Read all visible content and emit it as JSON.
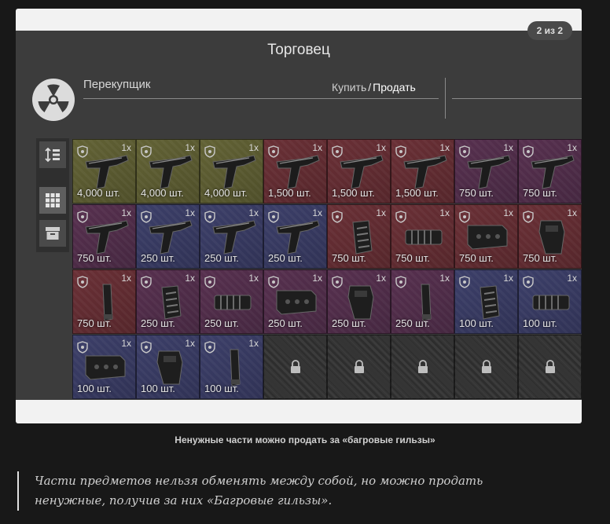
{
  "gallery": {
    "counter": "2 из 2"
  },
  "trader": {
    "title": "Торговец",
    "name": "Перекупщик",
    "buy_label": "Купить",
    "separator": "/",
    "sell_label": "Продать"
  },
  "sidebar": {
    "icons": [
      "sort-icon",
      "grid-view-icon",
      "box-icon"
    ]
  },
  "grid": {
    "cells": [
      {
        "color": "yellow",
        "qty": "1x",
        "amount": "4,000 шт.",
        "item": "pistol"
      },
      {
        "color": "yellow",
        "qty": "1x",
        "amount": "4,000 шт.",
        "item": "pistol"
      },
      {
        "color": "yellow",
        "qty": "1x",
        "amount": "4,000 шт.",
        "item": "pistol"
      },
      {
        "color": "red",
        "qty": "1x",
        "amount": "1,500 шт.",
        "item": "pistol"
      },
      {
        "color": "red",
        "qty": "1x",
        "amount": "1,500 шт.",
        "item": "pistol"
      },
      {
        "color": "red",
        "qty": "1x",
        "amount": "1,500 шт.",
        "item": "pistol"
      },
      {
        "color": "purple",
        "qty": "1x",
        "amount": "750 шт.",
        "item": "pistol"
      },
      {
        "color": "purple",
        "qty": "1x",
        "amount": "750 шт.",
        "item": "pistol"
      },
      {
        "color": "purple",
        "qty": "1x",
        "amount": "750 шт.",
        "item": "pistol"
      },
      {
        "color": "blue",
        "qty": "1x",
        "amount": "250 шт.",
        "item": "pistol"
      },
      {
        "color": "blue",
        "qty": "1x",
        "amount": "250 шт.",
        "item": "pistol"
      },
      {
        "color": "blue",
        "qty": "1x",
        "amount": "250 шт.",
        "item": "pistol"
      },
      {
        "color": "red",
        "qty": "1x",
        "amount": "750 шт.",
        "item": "grip"
      },
      {
        "color": "red",
        "qty": "1x",
        "amount": "750 шт.",
        "item": "muzzle"
      },
      {
        "color": "red",
        "qty": "1x",
        "amount": "750 шт.",
        "item": "handguard"
      },
      {
        "color": "red",
        "qty": "1x",
        "amount": "750 шт.",
        "item": "holster"
      },
      {
        "color": "red",
        "qty": "1x",
        "amount": "750 шт.",
        "item": "magazine"
      },
      {
        "color": "purple",
        "qty": "1x",
        "amount": "250 шт.",
        "item": "grip"
      },
      {
        "color": "purple",
        "qty": "1x",
        "amount": "250 шт.",
        "item": "muzzle"
      },
      {
        "color": "purple",
        "qty": "1x",
        "amount": "250 шт.",
        "item": "handguard"
      },
      {
        "color": "purple",
        "qty": "1x",
        "amount": "250 шт.",
        "item": "holster"
      },
      {
        "color": "purple",
        "qty": "1x",
        "amount": "250 шт.",
        "item": "magazine"
      },
      {
        "color": "blue",
        "qty": "1x",
        "amount": "100 шт.",
        "item": "grip"
      },
      {
        "color": "blue",
        "qty": "1x",
        "amount": "100 шт.",
        "item": "muzzle"
      },
      {
        "color": "blue",
        "qty": "1x",
        "amount": "100 шт.",
        "item": "handguard"
      },
      {
        "color": "blue",
        "qty": "1x",
        "amount": "100 шт.",
        "item": "holster"
      },
      {
        "color": "blue",
        "qty": "1x",
        "amount": "100 шт.",
        "item": "magazine"
      },
      {
        "color": "locked"
      },
      {
        "color": "locked"
      },
      {
        "color": "locked"
      },
      {
        "color": "locked"
      },
      {
        "color": "locked"
      }
    ]
  },
  "caption": "Ненужные части можно продать за «багровые гильзы»",
  "quote": "Части предметов нельзя обменять между собой, но можно продать ненужные, получив за них «Багровые гильзы».",
  "colors": {
    "yellow": "#5a5a30",
    "red": "#602b31",
    "purple": "#4e2c47",
    "blue": "#36395f",
    "locked": "#303030"
  }
}
